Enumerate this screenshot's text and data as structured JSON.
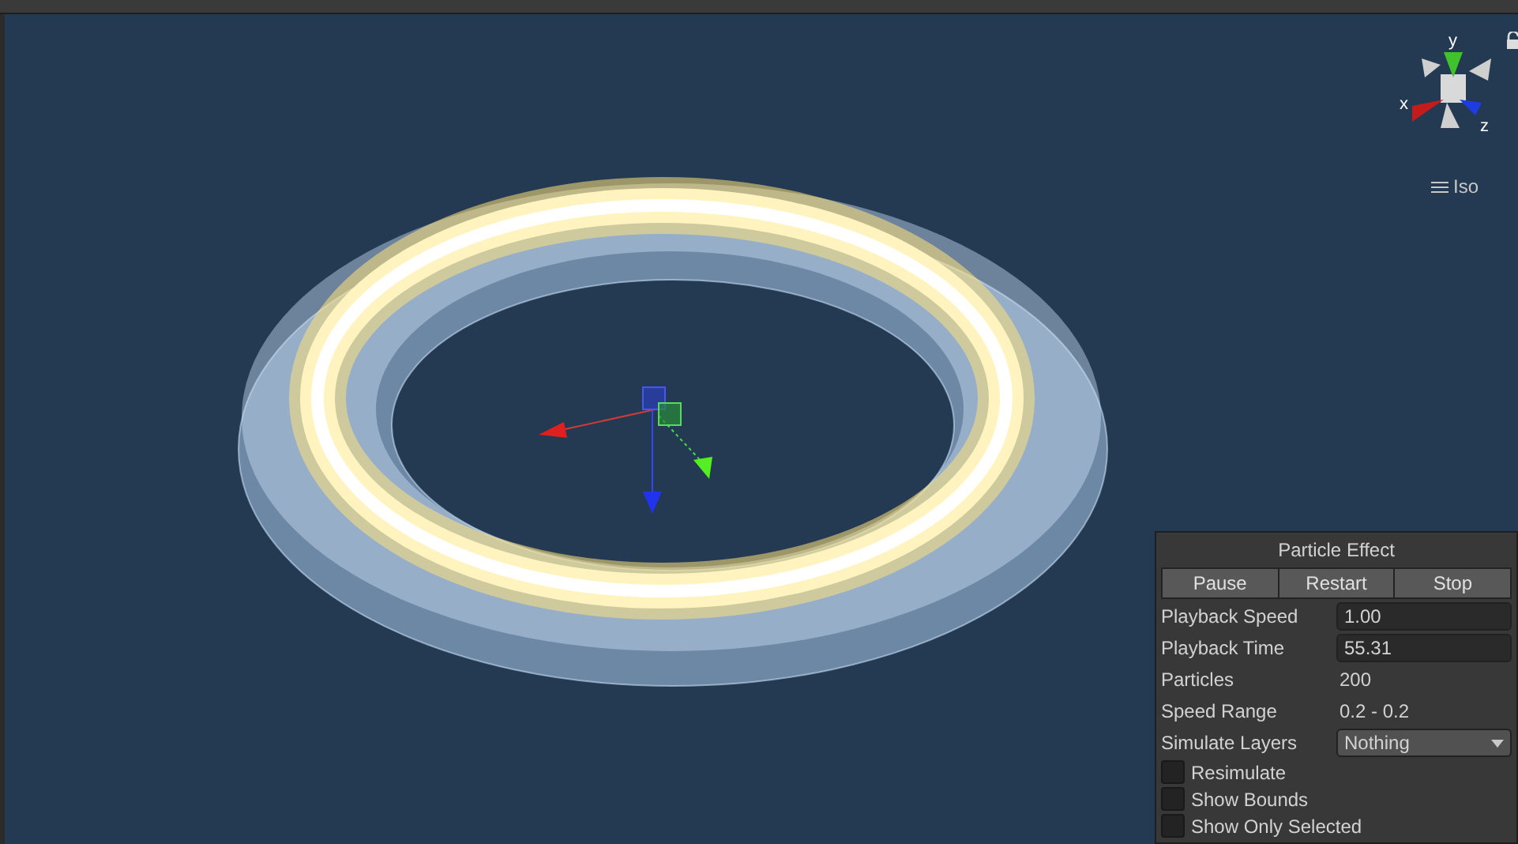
{
  "scene_gizmo": {
    "axis_labels": [
      "y",
      "x",
      "z"
    ],
    "projection": "Iso"
  },
  "particle_panel": {
    "title": "Particle Effect",
    "buttons": [
      "Pause",
      "Restart",
      "Stop"
    ],
    "rows": [
      {
        "kind": "field",
        "label": "Playback Speed",
        "value": "1.00"
      },
      {
        "kind": "field",
        "label": "Playback Time",
        "value": "55.31"
      },
      {
        "kind": "text",
        "label": "Particles",
        "value": "200"
      },
      {
        "kind": "text",
        "label": "Speed Range",
        "value": "0.2 - 0.2"
      },
      {
        "kind": "dropdown",
        "label": "Simulate Layers",
        "value": "Nothing"
      }
    ],
    "toggles": [
      {
        "label": "Resimulate",
        "checked": false
      },
      {
        "label": "Show Bounds",
        "checked": false
      },
      {
        "label": "Show Only Selected",
        "checked": false
      }
    ]
  }
}
